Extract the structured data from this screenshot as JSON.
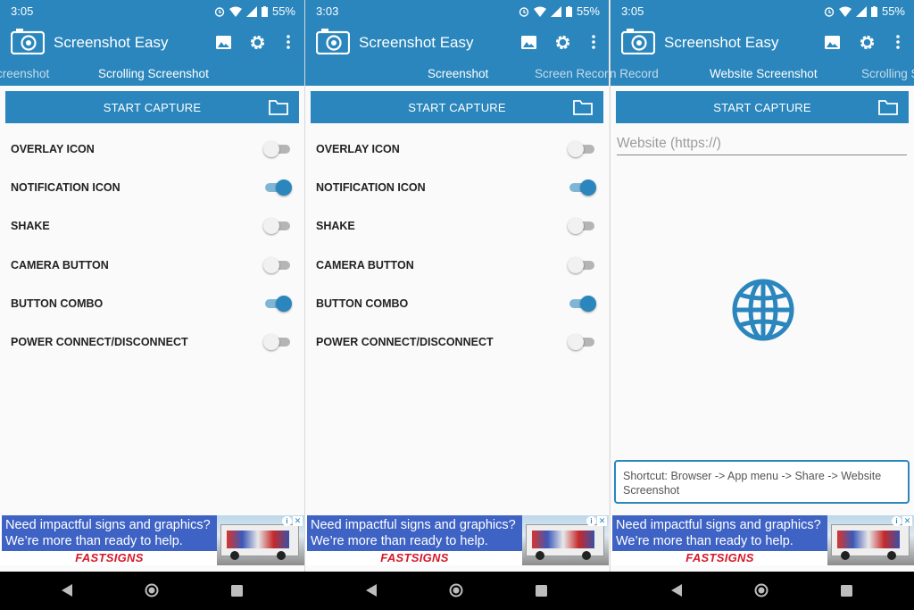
{
  "colors": {
    "primary": "#2a86bd",
    "switch_on_track": "#7fb6d6",
    "ad_blue": "#3e63c4",
    "ad_brand": "#d7182a"
  },
  "app": {
    "title": "Screenshot Easy"
  },
  "phones": [
    {
      "status": {
        "time": "3:05",
        "battery": "55%"
      },
      "tabs": [
        "creenshot",
        "Scrolling Screenshot"
      ],
      "capture_label": "START CAPTURE",
      "toggles": [
        {
          "label": "OVERLAY ICON",
          "on": false
        },
        {
          "label": "NOTIFICATION ICON",
          "on": true
        },
        {
          "label": "SHAKE",
          "on": false
        },
        {
          "label": "CAMERA BUTTON",
          "on": false
        },
        {
          "label": "BUTTON COMBO",
          "on": true
        },
        {
          "label": "POWER CONNECT/DISCONNECT",
          "on": false
        }
      ]
    },
    {
      "status": {
        "time": "3:03",
        "battery": "55%"
      },
      "tabs": [
        "Screenshot",
        "Screen Record"
      ],
      "capture_label": "START CAPTURE",
      "toggles": [
        {
          "label": "OVERLAY ICON",
          "on": false
        },
        {
          "label": "NOTIFICATION ICON",
          "on": true
        },
        {
          "label": "SHAKE",
          "on": false
        },
        {
          "label": "CAMERA BUTTON",
          "on": false
        },
        {
          "label": "BUTTON COMBO",
          "on": true
        },
        {
          "label": "POWER CONNECT/DISCONNECT",
          "on": false
        }
      ]
    },
    {
      "status": {
        "time": "3:05",
        "battery": "55%"
      },
      "tabs": [
        "n Record",
        "Website Screenshot",
        "Scrolling S"
      ],
      "capture_label": "START CAPTURE",
      "website_placeholder": "Website (https://)",
      "shortcut": "Shortcut: Browser -> App menu -> Share -> Website Screenshot"
    }
  ],
  "ad": {
    "line1": "Need impactful signs and graphics?",
    "line2": "We’re more than ready to help.",
    "brand": "FASTSIGNS"
  },
  "icons": {
    "logo": "camera-icon",
    "gallery": "image-icon",
    "settings": "gear-icon",
    "menu": "more-vert-icon",
    "folder": "folder-icon",
    "globe": "globe-icon",
    "back": "back-triangle-icon",
    "home": "home-circle-icon",
    "recents": "recents-square-icon"
  }
}
